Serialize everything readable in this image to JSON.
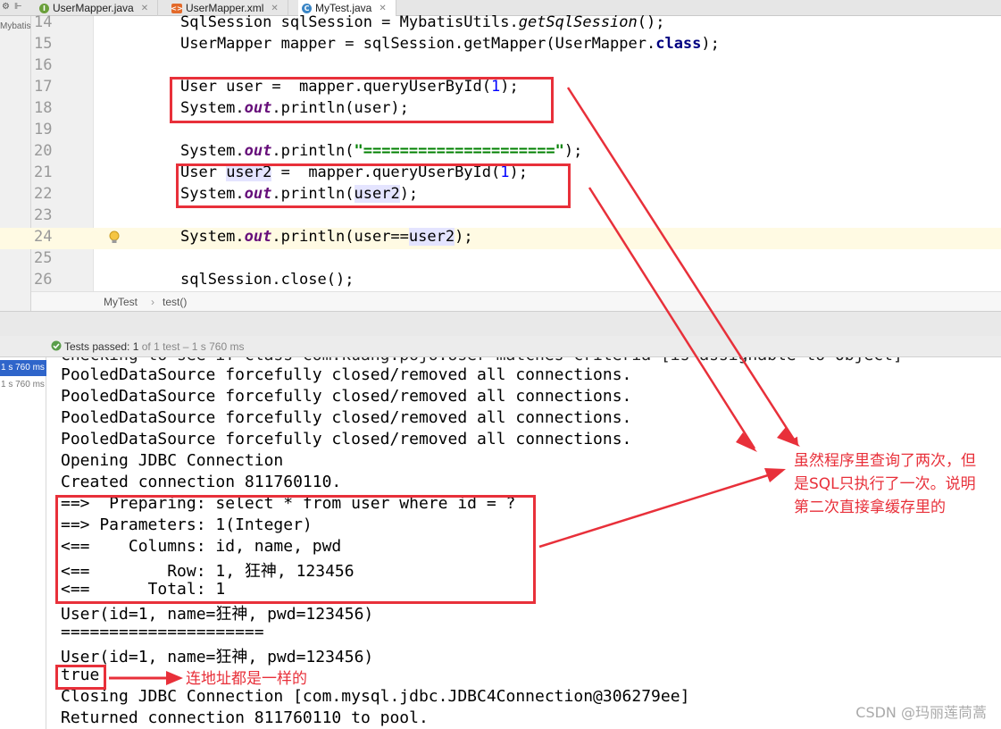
{
  "tabs": [
    {
      "label": "UserMapper.java",
      "icon": "interface-file-icon"
    },
    {
      "label": "UserMapper.xml",
      "icon": "xml-file-icon"
    },
    {
      "label": "MyTest.java",
      "icon": "class-file-icon"
    }
  ],
  "project_strip_label": "Mybatis",
  "editor": {
    "line_numbers": [
      "14",
      "15",
      "16",
      "17",
      "18",
      "19",
      "20",
      "21",
      "22",
      "23",
      "24",
      "25",
      "26"
    ]
  },
  "breadcrumb": {
    "class": "MyTest",
    "separator": "›",
    "method": "test()"
  },
  "run": {
    "passed_label": "Tests passed:",
    "passed_count": "1",
    "passed_detail": "of 1 test – 1 s 760 ms",
    "tree_items": [
      "1 s 760 ms",
      "1 s 760 ms"
    ]
  },
  "console": {
    "lines": [
      "Checking to see if class com.kuang.pojo.User matches criteria [is assignable to Object]",
      "PooledDataSource forcefully closed/removed all connections.",
      "PooledDataSource forcefully closed/removed all connections.",
      "PooledDataSource forcefully closed/removed all connections.",
      "PooledDataSource forcefully closed/removed all connections.",
      "Opening JDBC Connection",
      "Created connection 811760110.",
      "==>  Preparing: select * from user where id = ? ",
      "==> Parameters: 1(Integer)",
      "<==    Columns: id, name, pwd",
      "<==        Row: 1, 狂神, 123456",
      "<==      Total: 1",
      "User(id=1, name=狂神, pwd=123456)",
      "=====================",
      "User(id=1, name=狂神, pwd=123456)",
      "true",
      "Closing JDBC Connection [com.mysql.jdbc.JDBC4Connection@306279ee]",
      "Returned connection 811760110 to pool."
    ]
  },
  "annotations": {
    "note_main_lines": [
      "虽然程序里查询了两次，但",
      "是SQL只执行了一次。说明",
      "第二次直接拿缓存里的"
    ],
    "note_true": "连地址都是一样的",
    "accent_color": "#e8303a"
  },
  "watermark": "CSDN @玛丽莲茼蒿"
}
